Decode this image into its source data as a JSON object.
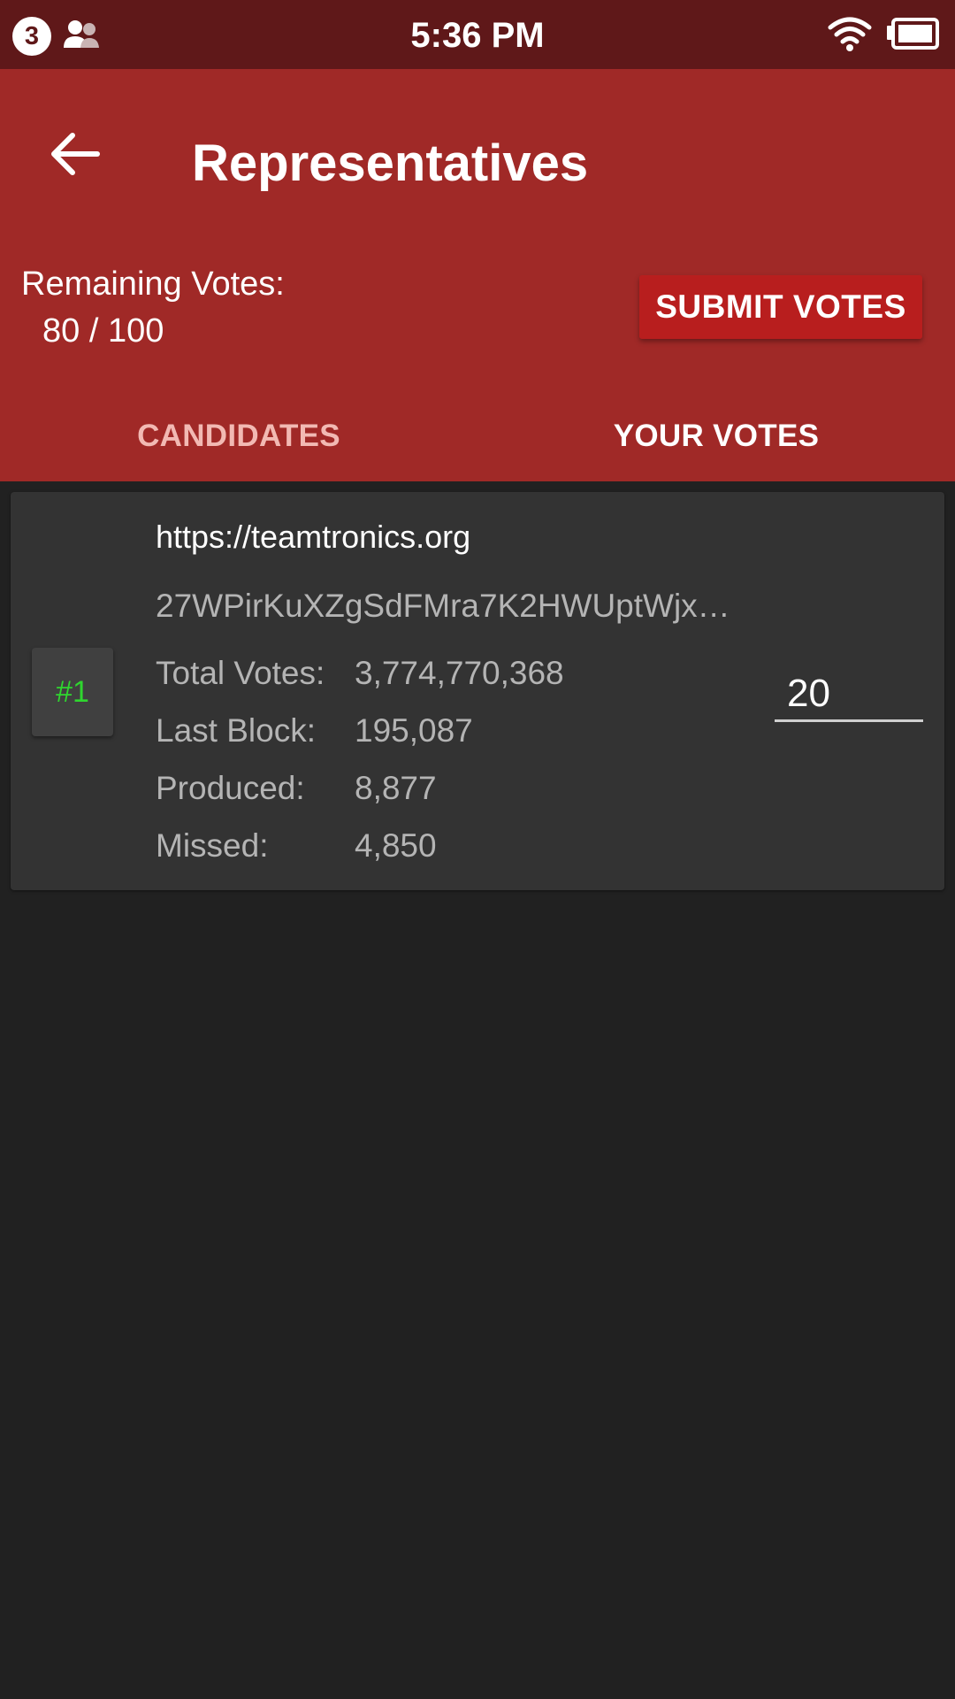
{
  "status_bar": {
    "notification_count": "3",
    "time": "5:36 PM",
    "icons": [
      "people-icon",
      "wifi-icon",
      "battery-icon"
    ]
  },
  "app_bar": {
    "title": "Representatives",
    "back_icon": "arrow-left-icon",
    "remaining_votes_label": "Remaining Votes:",
    "remaining_votes_value": "80 / 100",
    "submit_label": "SUBMIT VOTES",
    "tabs": [
      {
        "label": "CANDIDATES",
        "selected": false
      },
      {
        "label": "YOUR VOTES",
        "selected": true
      }
    ]
  },
  "representatives": [
    {
      "rank": "#1",
      "url": "https://teamtronics.org",
      "address": "27WPirKuXZgSdFMra7K2HWUptWjx…",
      "stats": [
        {
          "label": "Total Votes:",
          "value": "3,774,770,368"
        },
        {
          "label": "Last Block:",
          "value": "195,087"
        },
        {
          "label": "Produced:",
          "value": "8,877"
        },
        {
          "label": "Missed:",
          "value": "4,850"
        }
      ],
      "vote_input_value": "20"
    }
  ],
  "colors": {
    "status_bar": "#5f1819",
    "app_bar": "#a02927",
    "submit_button": "#b81e1e",
    "background": "#212121",
    "card": "#333333",
    "rank_text": "#2fd62f",
    "tab_inactive": "#f2b9b3"
  }
}
